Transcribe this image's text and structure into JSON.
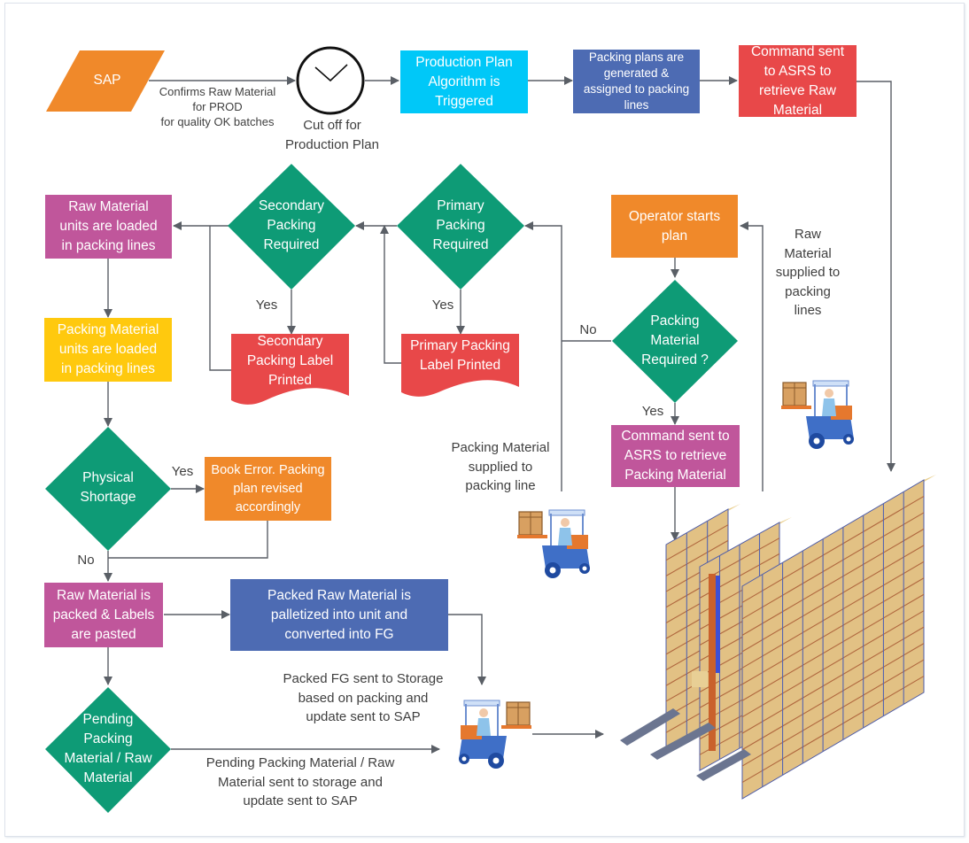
{
  "colors": {
    "orange": "#f0892a",
    "cyan": "#00c8f8",
    "blue": "#4d6bb3",
    "red": "#e84849",
    "magenta": "#c0569b",
    "yellow": "#ffc90e",
    "green": "#0e9b76",
    "connector": "#5a5f66",
    "text": "#3f3f3f"
  },
  "nodes": {
    "sap": "SAP",
    "cutoff": "Cut off for\nProduction Plan",
    "algorithm": "Production Plan\nAlgorithm is\nTriggered",
    "packing_plans": "Packing  plans are\ngenerated  &\nassigned to packing\nlines",
    "command_raw": "Command sent\nto ASRS to\nretrieve Raw\nMaterial",
    "operator": "Operator starts\nplan",
    "packing_material_required": "Packing\nMaterial\nRequired ?",
    "command_packing": "Command sent to\nASRS to retrieve\nPacking Material",
    "primary_required": "Primary\nPacking\nRequired",
    "primary_label": "Primary Packing\nLabel Printed",
    "secondary_required": "Secondary\nPacking\nRequired",
    "secondary_label": "Secondary\nPacking Label\nPrinted",
    "raw_loaded": "Raw Material\nunits are loaded\nin packing lines",
    "packing_loaded": "Packing Material\nunits are loaded\nin packing lines",
    "physical_shortage": "Physical\nShortage",
    "book_error": "Book Error. Packing\nplan revised\naccordingly",
    "raw_packed": "Raw Material is\npacked & Labels\nare pasted",
    "palletized": "Packed Raw Material is\npalletized into unit and\nconverted into FG",
    "pending": "Pending\nPacking\nMaterial / Raw\nMaterial"
  },
  "edge_labels": {
    "confirms": "Confirms Raw Material\nfor PROD\nfor quality OK batches",
    "raw_supplied": "Raw\nMaterial\nsupplied to\npacking\nlines",
    "packing_supplied": "Packing Material\nsupplied to\npacking line",
    "packed_fg": "Packed FG sent to Storage\nbased on packing and\nupdate sent to SAP",
    "pending_sent": "Pending Packing Material / Raw\nMaterial sent to storage and\nupdate sent to SAP",
    "yes": "Yes",
    "no": "No"
  },
  "icons": {
    "clock": "clock-icon",
    "forklift": "forklift-icon",
    "warehouse": "asrs-warehouse-icon"
  }
}
